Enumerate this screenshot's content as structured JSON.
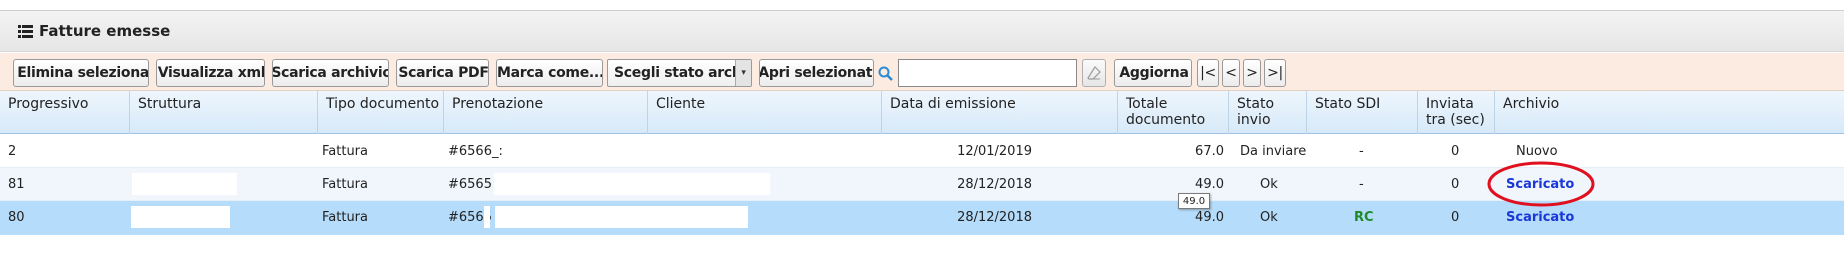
{
  "panel": {
    "title": "Fatture emesse",
    "icon": "list-icon"
  },
  "toolbar": {
    "delete_label": "Elimina selezionati",
    "view_xml_label": "Visualizza xml",
    "download_archive_label": "Scarica archivio",
    "download_pdf_label": "Scarica PDF",
    "mark_as_label": "Marca come...",
    "archive_state_select": {
      "selected": "Scegli stato archivio"
    },
    "open_selected_label": "Apri selezionati",
    "search": {
      "value": "",
      "placeholder": ""
    },
    "refresh_label": "Aggiorna",
    "nav": {
      "first": "|<",
      "prev": "<",
      "next": ">",
      "last": ">|"
    }
  },
  "table": {
    "columns": [
      "Progressivo",
      "Struttura",
      "Tipo documento",
      "Prenotazione",
      "Cliente",
      "Data di emissione",
      "Totale documento",
      "Stato invio",
      "Stato SDI",
      "Inviata tra (sec)",
      "Archivio"
    ],
    "rows": [
      {
        "progressivo": "2",
        "struttura": "",
        "tipo": "Fattura",
        "prenotazione": "#6566_:",
        "cliente": "",
        "data": "12/01/2019",
        "totale": "67.0",
        "stato_invio": "Da inviare",
        "stato_sdi": "-",
        "inviata_tra": "0",
        "archivio": "Nuovo"
      },
      {
        "progressivo": "81",
        "struttura": "",
        "tipo": "Fattura",
        "prenotazione": "#6565",
        "cliente": "",
        "data": "28/12/2018",
        "totale": "49.0",
        "stato_invio": "Ok",
        "stato_sdi": "-",
        "inviata_tra": "0",
        "archivio": "Scaricato"
      },
      {
        "progressivo": "80",
        "struttura": "",
        "tipo": "Fattura",
        "prenotazione": "#6565",
        "cliente": "",
        "data": "28/12/2018",
        "totale": "49.0",
        "stato_invio": "Ok",
        "stato_sdi": "RC",
        "inviata_tra": "0",
        "archivio": "Scaricato"
      }
    ]
  },
  "tooltip": {
    "text": "49.0"
  },
  "colors": {
    "link": "#1a37d8",
    "sdi_ok": "#1f8a2a",
    "selected_row": "#b5dcfa",
    "highlight_circle": "#e0101e",
    "delete_icon": "#d9231d",
    "toolbar_icon": "#2b8ad3"
  }
}
